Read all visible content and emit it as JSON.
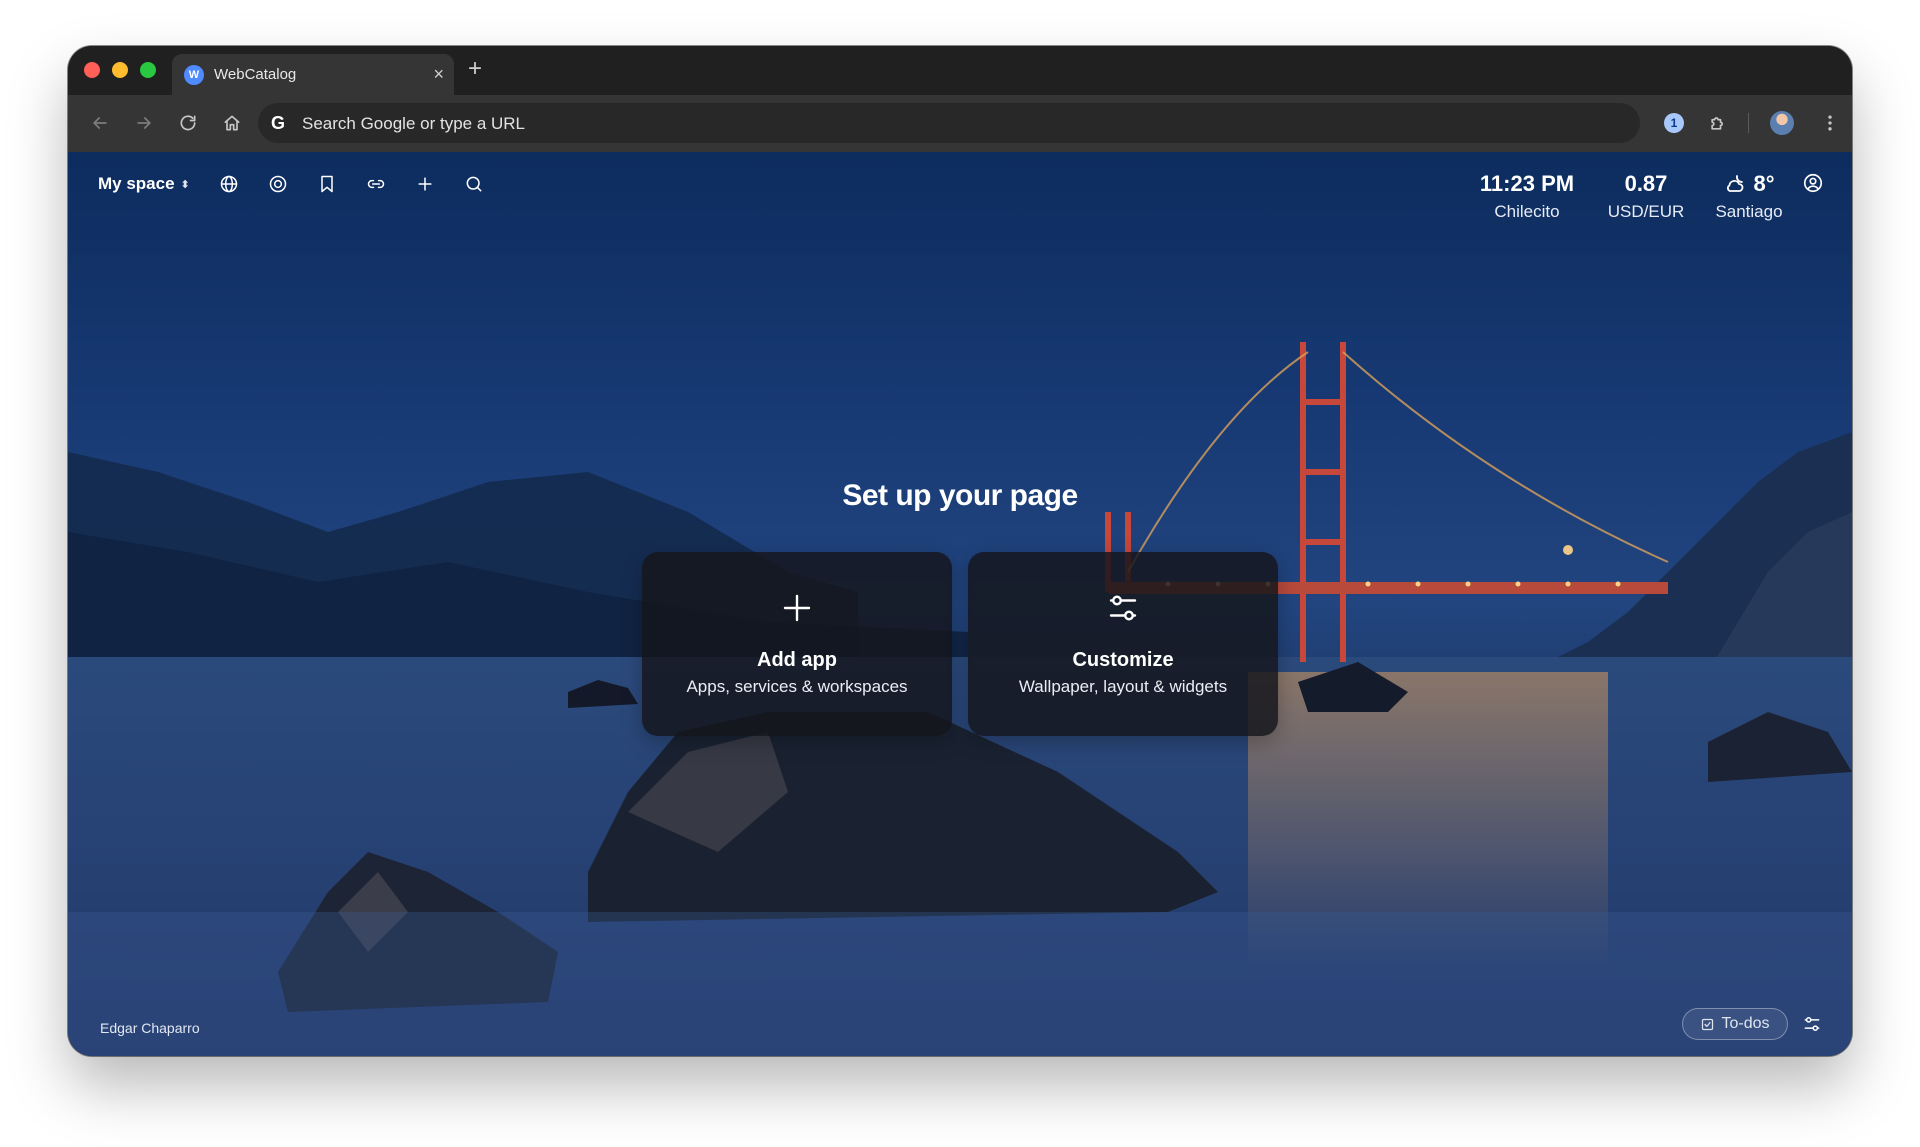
{
  "browser": {
    "tab": {
      "favicon": "W",
      "title": "WebCatalog",
      "close_glyph": "×"
    },
    "new_tab_glyph": "+",
    "google_glyph": "G",
    "password_glyph": "1",
    "address_bar": {
      "placeholder": "Search Google or type a URL"
    }
  },
  "topbar": {
    "space_label": "My space",
    "space_chevron": "⬍",
    "icons": [
      "globe-icon",
      "target-icon",
      "bookmark-icon",
      "link-icon",
      "plus-icon",
      "search-icon"
    ]
  },
  "widgets": {
    "clock": {
      "time": "11:23 PM",
      "location": "Chilecito"
    },
    "currency": {
      "rate": "0.87",
      "pair": "USD/EUR"
    },
    "weather": {
      "temperature": "8°",
      "location": "Santiago",
      "icon": "partly-cloudy-night-icon"
    }
  },
  "setup": {
    "title": "Set up your page",
    "add_app": {
      "title": "Add app",
      "subtitle": "Apps, services & workspaces"
    },
    "customize": {
      "title": "Customize",
      "subtitle": "Wallpaper, layout & widgets"
    }
  },
  "footer": {
    "photo_credit": "Edgar Chaparro",
    "todos_label": "To-dos"
  },
  "colors": {
    "titlebar": "#202020",
    "toolbar": "#353535",
    "omnibox": "#282828",
    "card_bg": "#14161c",
    "sky": "#183a75"
  }
}
